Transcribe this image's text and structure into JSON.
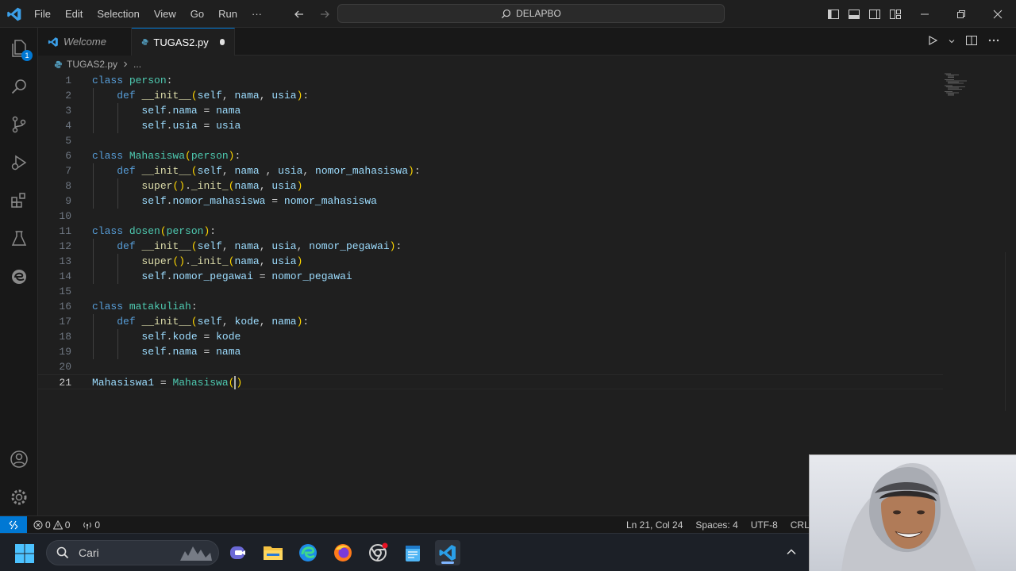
{
  "menu": [
    "File",
    "Edit",
    "Selection",
    "View",
    "Go",
    "Run",
    "···"
  ],
  "search": {
    "text": "DELAPBO"
  },
  "activity_badge": "1",
  "tabs": [
    {
      "label": "Welcome"
    },
    {
      "label": "TUGAS2.py"
    }
  ],
  "breadcrumb": {
    "file": "TUGAS2.py",
    "more": "..."
  },
  "editor": {
    "line_numbers": [
      "1",
      "2",
      "3",
      "4",
      "5",
      "6",
      "7",
      "8",
      "9",
      "10",
      "11",
      "12",
      "13",
      "14",
      "15",
      "16",
      "17",
      "18",
      "19",
      "20",
      "21"
    ],
    "lines": [
      "class person:",
      "    def __init__(self, nama, usia):",
      "        self.nama = nama",
      "        self.usia = usia",
      "",
      "class Mahasiswa(person):",
      "    def __init__(self, nama , usia, nomor_mahasiswa):",
      "        super()._init_(nama, usia)",
      "        self.nomor_mahasiswa = nomor_mahasiswa",
      "",
      "class dosen(person):",
      "    def __init__(self, nama, usia, nomor_pegawai):",
      "        super()._init_(nama, usia)",
      "        self.nomor_pegawai = nomor_pegawai",
      "",
      "class matakuliah:",
      "    def __init__(self, kode, nama):",
      "        self.kode = kode",
      "        self.nama = nama",
      "",
      "Mahasiswa1 = Mahasiswa()"
    ],
    "current_line": 21
  },
  "statusbar": {
    "errors": "0",
    "warnings": "0",
    "ports": "0",
    "position": "Ln 21, Col 24",
    "spaces": "Spaces: 4",
    "encoding": "UTF-8",
    "eol": "CRLF"
  },
  "taskbar": {
    "search_label": "Cari"
  },
  "colors": {
    "accent": "#0078d4",
    "keyword": "#569cd6",
    "class_name": "#4ec9b0",
    "function": "#dcdcaa",
    "parameter": "#9cdcfe"
  }
}
